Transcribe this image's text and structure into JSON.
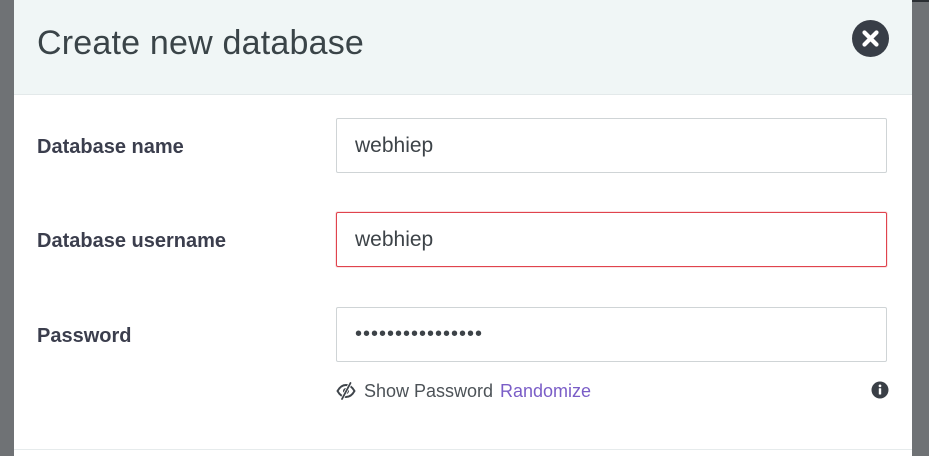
{
  "dialog": {
    "title": "Create new database",
    "close_icon": "close-circle-icon"
  },
  "form": {
    "database_name": {
      "label": "Database name",
      "value": "webhiep"
    },
    "database_username": {
      "label": "Database username",
      "value": "webhiep",
      "state": "invalid"
    },
    "password": {
      "label": "Password",
      "masked_value": "••••••••••••••••"
    },
    "show_password": {
      "label": "Show Password",
      "icon": "eye-slash-icon"
    },
    "randomize": {
      "label": "Randomize"
    },
    "info_icon": "info-circle-icon"
  },
  "colors": {
    "header_bg": "#f0f6f6",
    "accent_link": "#7a5dc7",
    "error_border": "#e0434d",
    "close_button": "#383e47"
  }
}
